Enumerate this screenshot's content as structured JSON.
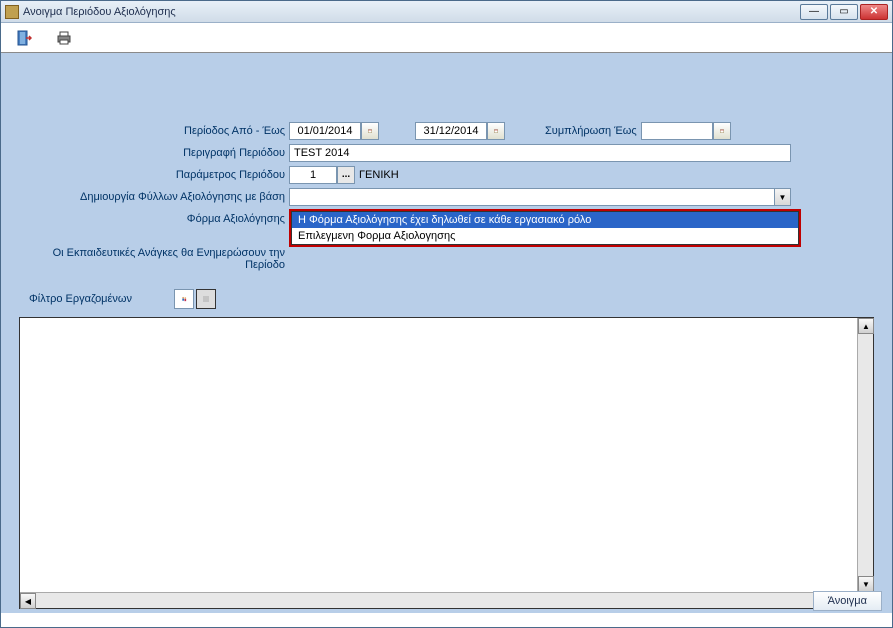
{
  "window": {
    "title": "Ανοιγμα Περιόδου Αξιολόγησης"
  },
  "form": {
    "period_label": "Περίοδος Από - Έως",
    "date_from": "01/01/2014",
    "date_to": "31/12/2014",
    "fill_until_label": "Συμπλήρωση Έως",
    "fill_until": "",
    "description_label": "Περιγραφή Περιόδου",
    "description": "TEST 2014",
    "param_label": "Παράμετρος Περιόδου",
    "param_value": "1",
    "param_text": "ΓΕΝΙΚΗ",
    "sheets_basis_label": "Δημιουργία Φύλλων Αξιολόγησης με βάση",
    "eval_form_label": "Φόρμα Αξιολόγησης",
    "edu_needs_label": "Οι Εκπαιδευτικές Ανάγκες θα Ενημερώσουν την Περίοδο",
    "filter_label": "Φίλτρο Εργαζομένων"
  },
  "dropdown": {
    "option_selected": "Η Φόρμα Αξιολόγησης έχει δηλωθεί σε κάθε εργασιακό ρόλο",
    "option_other": "Επιλεγμενη Φορμα Αξιολογησης"
  },
  "footer": {
    "open_button": "Άνοιγμα"
  }
}
